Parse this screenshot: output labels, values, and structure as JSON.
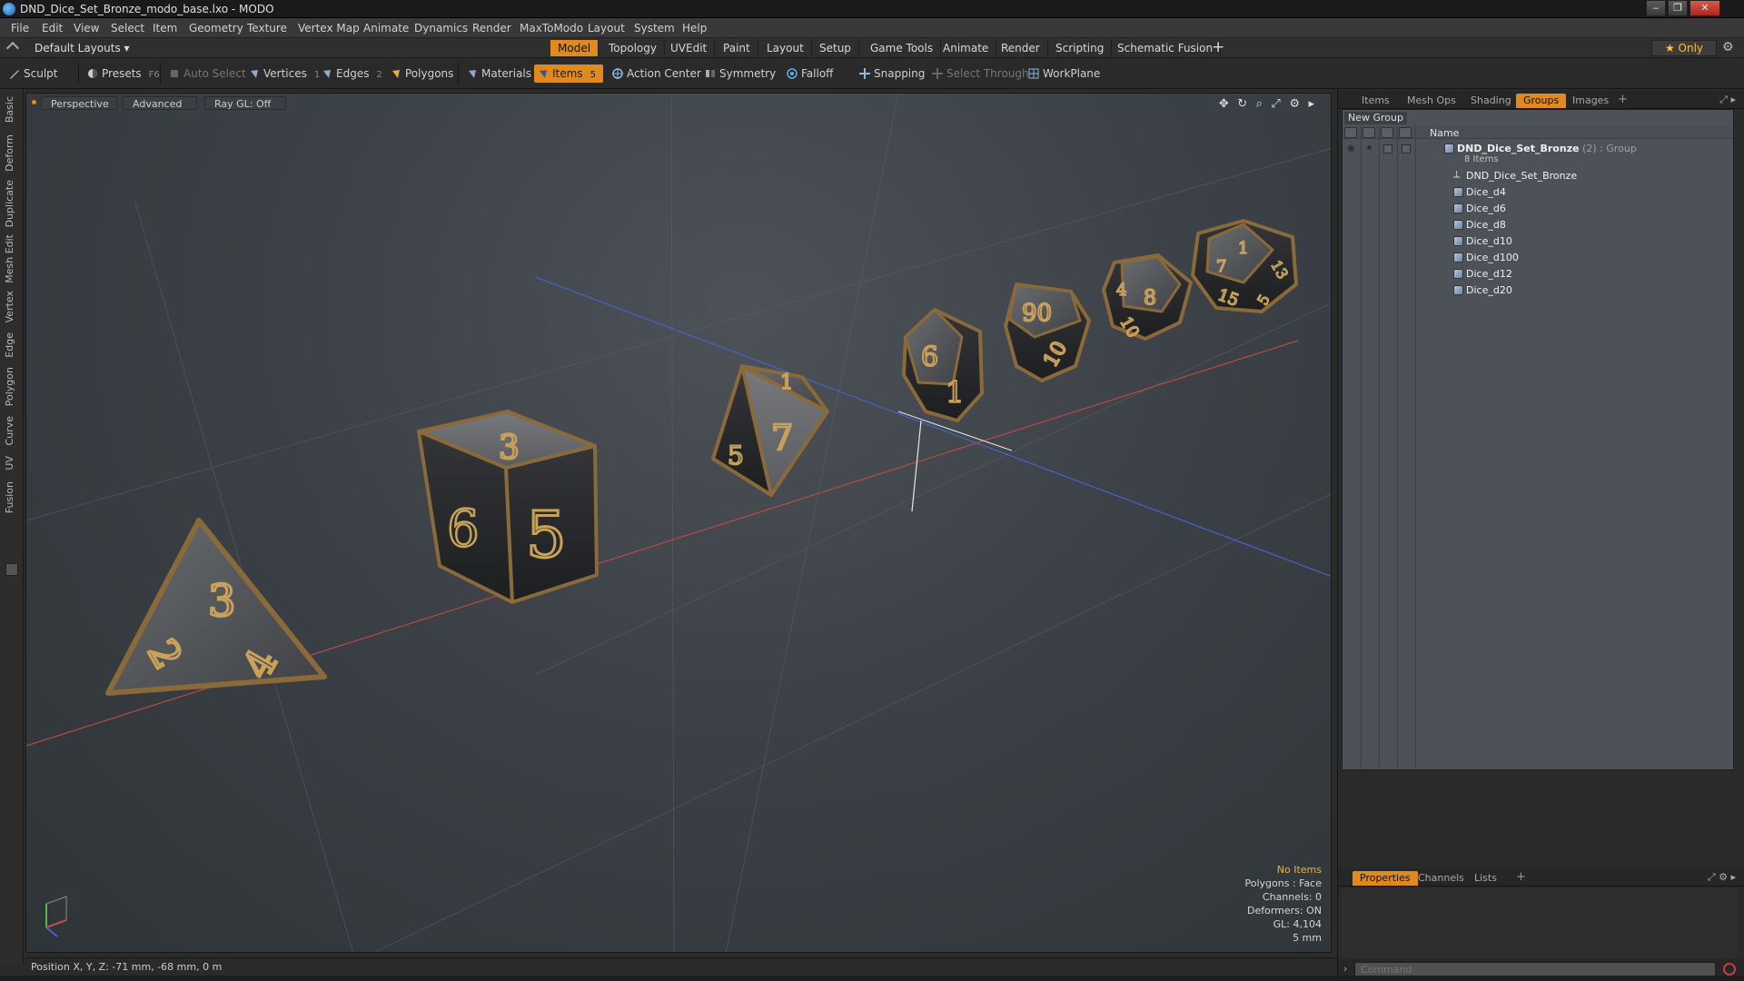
{
  "window": {
    "title": "DND_Dice_Set_Bronze_modo_base.lxo - MODO",
    "controls": [
      "‒",
      "❐",
      "✕"
    ]
  },
  "menu": [
    "File",
    "Edit",
    "View",
    "Select",
    "Item",
    "Geometry",
    "Texture",
    "Vertex Map",
    "Animate",
    "Dynamics",
    "Render",
    "MaxToModo",
    "Layout",
    "System",
    "Help"
  ],
  "layout_bar": {
    "layout_selector": "Default Layouts ▾",
    "tabs": [
      "Model",
      "Topology",
      "UVEdit",
      "Paint",
      "Layout",
      "Setup",
      "Game Tools",
      "Animate",
      "Render",
      "Scripting",
      "Schematic Fusion"
    ],
    "active_tab": "Model",
    "add": "+",
    "only_button": "★  Only"
  },
  "toolbar": {
    "sculpt": "Sculpt",
    "presets": "Presets",
    "presets_key": "F6",
    "auto_select": "Auto Select",
    "vertices": "Vertices",
    "vertices_count": "1",
    "edges": "Edges",
    "edges_count": "2",
    "polygons": "Polygons",
    "materials": "Materials",
    "items": "Items",
    "items_count": "5",
    "action_center": "Action Center",
    "symmetry": "Symmetry",
    "falloff": "Falloff",
    "snapping": "Snapping",
    "select_through": "Select Through",
    "workplane": "WorkPlane"
  },
  "left_tabs": [
    "Basic",
    "Deform",
    "Duplicate",
    "Mesh Edit",
    "Vertex",
    "Edge",
    "Polygon",
    "Curve",
    "UV",
    "Fusion"
  ],
  "viewport": {
    "view_mode": "Perspective",
    "shading": "Advanced",
    "raygl": "Ray GL: Off",
    "info": {
      "selection": "No Items",
      "polygons": "Polygons : Face",
      "channels": "Channels: 0",
      "deformers": "Deformers: ON",
      "gl": "GL: 4,104",
      "scale": "5 mm"
    },
    "dice": [
      {
        "name": "d4",
        "numbers": [
          "3",
          "2",
          "4"
        ]
      },
      {
        "name": "d6",
        "numbers": [
          "3",
          "6",
          "5"
        ]
      },
      {
        "name": "d8",
        "numbers": [
          "1",
          "7",
          "5"
        ]
      },
      {
        "name": "d10",
        "numbers": [
          "6",
          "1"
        ]
      },
      {
        "name": "d100",
        "numbers": [
          "90",
          "10"
        ]
      },
      {
        "name": "d12",
        "numbers": [
          "4",
          "8",
          "10"
        ]
      },
      {
        "name": "d20",
        "numbers": [
          "1",
          "7",
          "13",
          "15",
          "5"
        ]
      }
    ]
  },
  "status_bar": {
    "position": "Position X, Y, Z:   -71 mm, -68 mm, 0 m"
  },
  "right_panel": {
    "top_tabs": [
      "Items",
      "Mesh Ops",
      "Shading",
      "Groups",
      "Images"
    ],
    "active_top_tab": "Groups",
    "new_group": "New Group",
    "name_header": "Name",
    "group": {
      "name": "DND_Dice_Set_Bronze",
      "suffix": " (2) : Group",
      "count": "8 Items",
      "children": [
        "DND_Dice_Set_Bronze",
        "Dice_d4",
        "Dice_d6",
        "Dice_d8",
        "Dice_d10",
        "Dice_d100",
        "Dice_d12",
        "Dice_d20"
      ]
    },
    "bottom_tabs": [
      "Properties",
      "Channels",
      "Lists"
    ],
    "active_bottom_tab": "Properties",
    "command_placeholder": "Command"
  },
  "colors": {
    "accent": "#e08a1e",
    "viewport_bg": "#3b4146",
    "dice_body": "#4d4f52",
    "dice_rim": "#8a6a3a",
    "axis_x": "#c0504d",
    "axis_z": "#4a6ad0"
  }
}
